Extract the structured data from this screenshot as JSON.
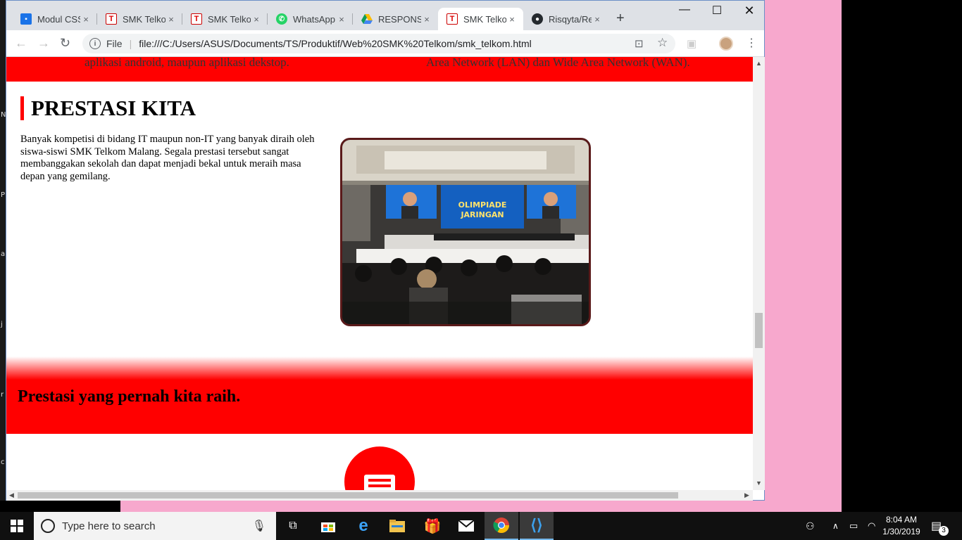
{
  "desktop": {
    "edge_letters": [
      "N",
      "P",
      "a",
      "j",
      "r",
      "c"
    ]
  },
  "browser": {
    "tabs": [
      {
        "title": "Modul CSS",
        "icon": "docs-icon",
        "active": false
      },
      {
        "title": "SMK Telkom",
        "icon": "telkom-icon",
        "active": false
      },
      {
        "title": "SMK Telkom",
        "icon": "telkom-icon",
        "active": false
      },
      {
        "title": "WhatsApp",
        "icon": "whatsapp-icon",
        "active": false
      },
      {
        "title": "RESPONSIV",
        "icon": "drive-icon",
        "active": false
      },
      {
        "title": "SMK Telkom",
        "icon": "telkom-icon",
        "active": true
      },
      {
        "title": "Risqyta/Re",
        "icon": "github-icon",
        "active": false
      }
    ],
    "close_glyph": "×",
    "new_tab_glyph": "+",
    "scheme_label": "File",
    "url": "file:///C:/Users/ASUS/Documents/TS/Produktif/Web%20SMK%20Telkom/smk_telkom.html"
  },
  "page": {
    "top_band_left": "aplikasi android, maupun aplikasi dekstop.",
    "top_band_right": "Area Network (LAN) dan Wide Area Network (WAN).",
    "section_title": "PRESTASI KITA",
    "section_text": "Banyak kompetisi di bidang IT maupun non-IT yang banyak diraih oleh siswa-siswi SMK Telkom Malang. Segala prestasi tersebut sangat membanggakan sekolah dan dapat menjadi bekal untuk meraih masa depan yang gemilang.",
    "photo": {
      "screen_title_top": "OLIMPIADE",
      "screen_title_bottom": "JARINGAN"
    },
    "band_text": "Prestasi yang pernah kita raih."
  },
  "taskbar": {
    "search_placeholder": "Type here to search",
    "time": "8:04 AM",
    "date": "1/30/2019",
    "notification_count": "3"
  },
  "colors": {
    "accent_red": "#ff0000",
    "desktop_pink": "#f7a8cd",
    "taskbar": "#101010"
  }
}
